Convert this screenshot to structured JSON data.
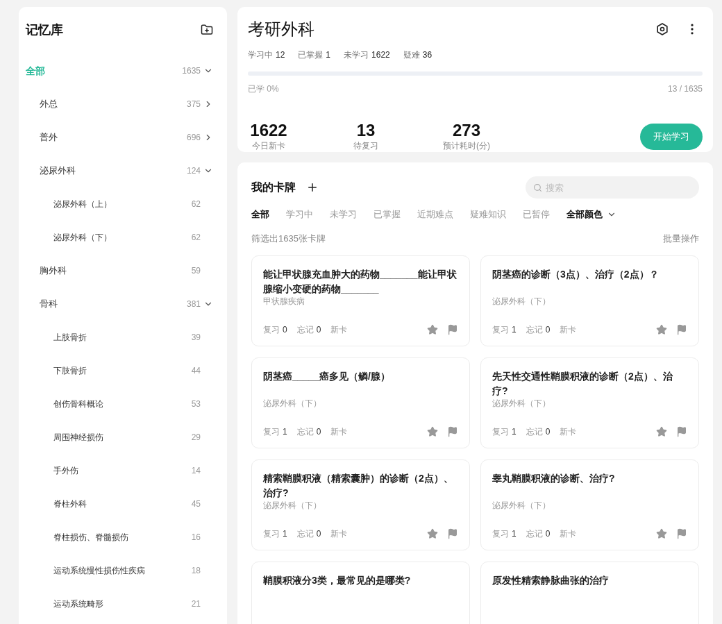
{
  "sidebar": {
    "title": "记忆库",
    "tree": [
      {
        "label": "全部",
        "count": "1635",
        "selected": true,
        "expanded": true,
        "children": [
          {
            "label": "外总",
            "count": "375",
            "selected": false,
            "expanded": false
          },
          {
            "label": "普外",
            "count": "696",
            "selected": false,
            "expanded": false
          },
          {
            "label": "泌尿外科",
            "count": "124",
            "selected": false,
            "expanded": true,
            "children": [
              {
                "label": "泌尿外科（上）",
                "count": "62",
                "selected": false
              },
              {
                "label": "泌尿外科（下）",
                "count": "62",
                "selected": false
              }
            ]
          },
          {
            "label": "胸外科",
            "count": "59",
            "selected": false
          },
          {
            "label": "骨科",
            "count": "381",
            "selected": false,
            "expanded": true,
            "children": [
              {
                "label": "上肢骨折",
                "count": "39",
                "selected": false
              },
              {
                "label": "下肢骨折",
                "count": "44",
                "selected": false
              },
              {
                "label": "创伤骨科概论",
                "count": "53",
                "selected": false
              },
              {
                "label": "周围神经损伤",
                "count": "29",
                "selected": false
              },
              {
                "label": "手外伤",
                "count": "14",
                "selected": false
              },
              {
                "label": "脊柱外科",
                "count": "45",
                "selected": false
              },
              {
                "label": "脊柱损伤、脊髓损伤",
                "count": "16",
                "selected": false
              },
              {
                "label": "运动系统慢性损伤性疾病",
                "count": "18",
                "selected": false
              },
              {
                "label": "运动系统畸形",
                "count": "21",
                "selected": false
              }
            ]
          }
        ]
      }
    ]
  },
  "deck": {
    "title": "考研外科",
    "stats": [
      {
        "label": "学习中",
        "value": "12"
      },
      {
        "label": "已掌握",
        "value": "1"
      },
      {
        "label": "未学习",
        "value": "1622"
      },
      {
        "label": "疑难",
        "value": "36"
      }
    ],
    "progress": {
      "level": 0,
      "label": "已学 0%",
      "ratio": "13 / 1635"
    },
    "figures": [
      {
        "value": "1622",
        "label": "今日新卡"
      },
      {
        "value": "13",
        "label": "待复习"
      },
      {
        "value": "273",
        "label": "预计耗时(分)"
      }
    ],
    "start_button": "开始学习"
  },
  "cards_panel": {
    "title": "我的卡牌",
    "search": {
      "placeholder": "搜索"
    },
    "filters": [
      {
        "label": "全部",
        "selected": true
      },
      {
        "label": "学习中",
        "selected": false
      },
      {
        "label": "未学习",
        "selected": false
      },
      {
        "label": "已掌握",
        "selected": false
      },
      {
        "label": "近期难点",
        "selected": false
      },
      {
        "label": "疑难知识",
        "selected": false
      },
      {
        "label": "已暂停",
        "selected": false
      }
    ],
    "color_filter": "全部颜色",
    "result": "筛选出1635张卡牌",
    "batch": "批量操作",
    "cards": [
      {
        "title": "能让甲状腺充血肿大的药物_______能让甲状腺缩小变硬的药物_______",
        "category": "甲状腺疾病",
        "review_label": "复习",
        "review": "0",
        "forget_label": "忘记",
        "forget": "0",
        "tag": "新卡"
      },
      {
        "title": "阴茎癌的诊断（3点）、治疗（2点）？",
        "category": "泌尿外科（下）",
        "review_label": "复习",
        "review": "1",
        "forget_label": "忘记",
        "forget": "0",
        "tag": "新卡"
      },
      {
        "title": "阴茎癌_____癌多见（鳞/腺）",
        "category": "泌尿外科（下）",
        "review_label": "复习",
        "review": "1",
        "forget_label": "忘记",
        "forget": "0",
        "tag": "新卡"
      },
      {
        "title": "先天性交通性鞘膜积液的诊断（2点）、治疗?",
        "category": "泌尿外科（下）",
        "review_label": "复习",
        "review": "1",
        "forget_label": "忘记",
        "forget": "0",
        "tag": "新卡"
      },
      {
        "title": "精索鞘膜积液（精索囊肿）的诊断（2点）、治疗?",
        "category": "泌尿外科（下）",
        "review_label": "复习",
        "review": "1",
        "forget_label": "忘记",
        "forget": "0",
        "tag": "新卡"
      },
      {
        "title": "睾丸鞘膜积液的诊断、治疗?",
        "category": "泌尿外科（下）",
        "review_label": "复习",
        "review": "1",
        "forget_label": "忘记",
        "forget": "0",
        "tag": "新卡"
      },
      {
        "title": "鞘膜积液分3类，最常见的是哪类?"
      },
      {
        "title": "原发性精索静脉曲张的治疗"
      }
    ]
  }
}
